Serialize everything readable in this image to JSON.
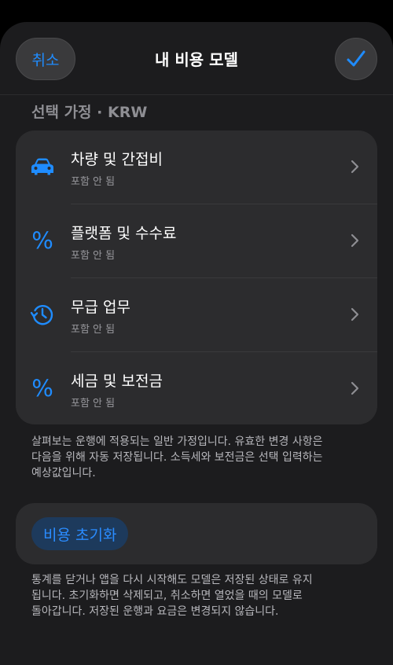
{
  "header": {
    "cancel_label": "취소",
    "title": "내 비용 모델",
    "confirm_icon": "checkmark-icon"
  },
  "section": {
    "title": "선택 가정 · KRW"
  },
  "items": [
    {
      "icon": "car-icon",
      "label": "차량 및 간접비",
      "status": "포함 안 됨"
    },
    {
      "icon": "percent-icon",
      "label": "플랫폼 및 수수료",
      "status": "포함 안 됨"
    },
    {
      "icon": "history-clock-icon",
      "label": "무급 업무",
      "status": "포함 안 됨"
    },
    {
      "icon": "percent-icon",
      "label": "세금 및 보전금",
      "status": "포함 안 됨"
    }
  ],
  "assumptions_note": {
    "line1": "살펴보는 운행에 적용되는 일반 가정입니다. 유효한 변경 사항은",
    "line2": "다음을 위해 자동 저장됩니다. 소득세와 보전금은 선택 입력하는",
    "line3": "예상값입니다."
  },
  "reset": {
    "label": "비용 초기화"
  },
  "reset_note": {
    "line1": "통계를 닫거나 앱을 다시 시작해도 모델은 저장된 상태로 유지",
    "line2": "됩니다. 초기화하면 삭제되고, 취소하면 열었을 때의 모델로",
    "line3": "돌아갑니다. 저장된 운행과 요금은 변경되지 않습니다."
  },
  "colors": {
    "accent": "#1f8cff",
    "background": "#1c1c1e",
    "card": "#2c2c2e"
  }
}
